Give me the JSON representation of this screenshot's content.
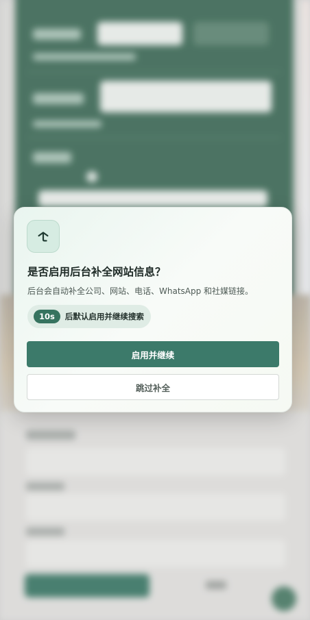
{
  "dialog": {
    "icon": "enrich-refresh-icon",
    "title": "是否启用后台补全网站信息？",
    "description": "后台会自动补全公司、网站、电话、WhatsApp 和社媒链接。",
    "countdown_value": "10s",
    "countdown_text": "后默认启用并继续搜索",
    "primary_label": "启用并继续",
    "secondary_label": "跳过补全"
  },
  "colors": {
    "accent": "#3c7a6a",
    "badge": "#36735f",
    "icon_bg": "#d6ece2",
    "title": "#1e2a26"
  }
}
